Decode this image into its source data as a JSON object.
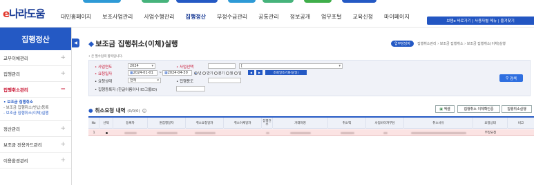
{
  "header": {
    "logo_prefix": "e",
    "logo_text": "나라도움",
    "nav": [
      "대민홈페이지",
      "보조사업관리",
      "사업수행관리",
      "집행정산",
      "부정수급관리",
      "공통관리",
      "정보공개",
      "업무포털",
      "교육신청",
      "마이페이지"
    ],
    "active_nav": "집행정산",
    "util_links": "보탬e 바로가기 | 사용자별 메뉴 | 즐겨찾기",
    "strip_colors": [
      "#2e9ad6",
      "#46b37b",
      "#2459c4",
      "#2e9ad6",
      "#46b37b",
      "#3fae4a",
      "#2459c4"
    ]
  },
  "sidebar": {
    "title": "집행정산",
    "items": [
      {
        "label": "교부이체관리",
        "toggle": "+"
      },
      {
        "label": "집행관리",
        "toggle": "+"
      },
      {
        "label": "집행취소관리",
        "toggle": "−"
      },
      {
        "label": "정산관리",
        "toggle": "+"
      },
      {
        "label": "보조금 전용카드관리",
        "toggle": "+"
      },
      {
        "label": "이용환경관리",
        "toggle": "+"
      }
    ],
    "submenu": {
      "heading": "• 보조금 집행취소",
      "links": [
        "- 보조금 집행취소(반납)등록",
        "- 보조금 집행취소(이체)실행"
      ]
    },
    "collapse_icon": "◀"
  },
  "page": {
    "title_icon": "◆",
    "title": "보조금 집행취소(이체)실행",
    "guide_button": "업무담당자",
    "breadcrumb": "집행취소관리 › 보조금 집행취소 › 보조금 집행취소(이체)실행",
    "required_note": "• 은 필수입력 항목입니다."
  },
  "search": {
    "year_label": "• 사업연도",
    "year_value": "2024",
    "business_label": "• 사업선택",
    "business_value": "[",
    "period_label": "• 요청일자",
    "date_from": "2024-01-01",
    "date_to": "2024-04-30",
    "period_options": [
      "년",
      "반기",
      "분기",
      "월",
      "일"
    ],
    "prev_btn": "◀",
    "next_btn": "▶",
    "info_btn": "조회일조기화(당일)",
    "status_label": "• 요청상태",
    "status_value": "전체",
    "exec_purpose_label": "• 집행용도",
    "registrant_label": "• 집행등록자 (한글이름이나 ID그룹ID)",
    "search_button": "검색",
    "date_tilde": "~"
  },
  "list": {
    "dot": "●",
    "title": "취소요청 내역",
    "count_text": "(0/0/0)",
    "info_icon": "i",
    "excel_button": "엑셀",
    "btn_transfer_confirm": "집행취소 이체확인증",
    "btn_execute": "집행취소실행",
    "columns": [
      "No",
      "선택",
      "등록자",
      "원집행일자",
      "취소요청일자",
      "취소이체일자",
      "집행건수",
      "거래처명",
      "취소액",
      "사업비이자부담",
      "취소사유",
      "요청상태",
      "비고"
    ],
    "rows": [
      {
        "no": "1",
        "status": "부정요청"
      }
    ]
  }
}
